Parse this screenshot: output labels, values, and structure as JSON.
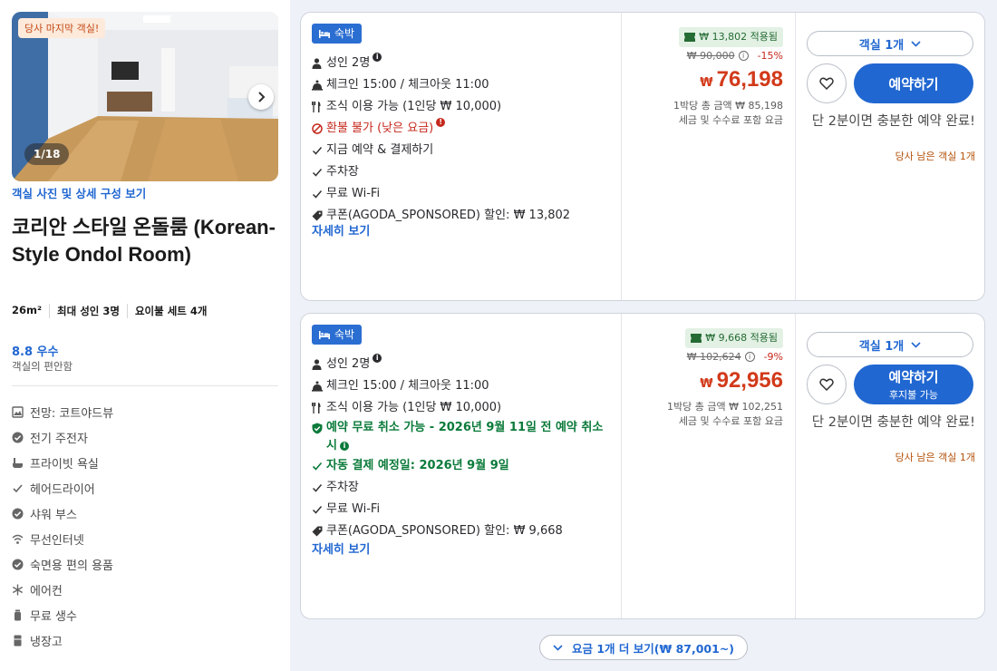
{
  "room": {
    "badge": "당사 마지막 객실!",
    "photo_counter": "1/18",
    "photo_link": "객실 사진 및 상세 구성 보기",
    "title": "코리안 스타일 온돌룸 (Korean-Style Ondol Room)",
    "specs": [
      "26m²",
      "최대 성인 3명",
      "요이불 세트 4개"
    ],
    "score": "8.8 우수",
    "score_sub": "객실의 편안함",
    "amenities": [
      {
        "icon": "view-icon",
        "label": "전망: 코트야드뷰"
      },
      {
        "icon": "check-circle-icon",
        "label": "전기 주전자"
      },
      {
        "icon": "bathtub-icon",
        "label": "프라이빗 욕실"
      },
      {
        "icon": "check-icon",
        "label": "헤어드라이어"
      },
      {
        "icon": "check-circle-icon",
        "label": "샤워 부스"
      },
      {
        "icon": "wifi-icon",
        "label": "무선인터넷"
      },
      {
        "icon": "check-circle-icon",
        "label": "숙면용 편의 용품"
      },
      {
        "icon": "snowflake-icon",
        "label": "에어컨"
      },
      {
        "icon": "water-drop-icon",
        "label": "무료 생수"
      },
      {
        "icon": "fridge-icon",
        "label": "냉장고"
      }
    ]
  },
  "offers": [
    {
      "stay_badge": "숙박",
      "features": {
        "adults": "성인 2명",
        "checkin": "체크인 15:00 / 체크아웃 11:00",
        "breakfast": "조식 이용 가능 (1인당 ₩ 10,000)",
        "refund": "환불 불가 (낮은 요금)",
        "pay_now": "지금 예약 & 결제하기",
        "parking": "주차장",
        "wifi": "무료 Wi-Fi",
        "coupon": "쿠폰(AGODA_SPONSORED) 할인: ₩ 13,802"
      },
      "detail_link": "자세히 보기",
      "coupon_chip": "₩ 13,802 적용됨",
      "original_price": "₩ 90,000",
      "discount": "-15%",
      "currency": "₩",
      "price": "76,198",
      "total": "1박당 총 금액 ₩ 85,198",
      "tax_note": "세금 및 수수료 포함 요금",
      "room_select": "객실 1개",
      "book_label": "예약하기",
      "hurry": "단 2분이면 충분한 예약 완료!",
      "rooms_left": "당사 남은 객실 1개"
    },
    {
      "stay_badge": "숙박",
      "features": {
        "adults": "성인 2명",
        "checkin": "체크인 15:00 / 체크아웃 11:00",
        "breakfast": "조식 이용 가능 (1인당 ₩ 10,000)",
        "free_cancel": "예약 무료 취소 가능 - 2026년 9월 11일 전 예약 취소 시",
        "auto_pay": "자동 결제 예정일: 2026년 9월 9일",
        "parking": "주차장",
        "wifi": "무료 Wi-Fi",
        "coupon": "쿠폰(AGODA_SPONSORED) 할인: ₩ 9,668"
      },
      "detail_link": "자세히 보기",
      "coupon_chip": "₩ 9,668 적용됨",
      "original_price": "₩ 102,624",
      "discount": "-9%",
      "currency": "₩",
      "price": "92,956",
      "total": "1박당 총 금액 ₩ 102,251",
      "tax_note": "세금 및 수수료 포함 요금",
      "room_select": "객실 1개",
      "book_label": "예약하기",
      "book_sub": "후지불 가능",
      "hurry": "단 2분이면 충분한 예약 완료!",
      "rooms_left": "당사 남은 객실 1개"
    }
  ],
  "more_rates": "요금 1개 더 보기(₩ 87,001~)",
  "colors": {
    "primary": "#2167d1",
    "price_red": "#d23a1a",
    "green": "#0b7a3a",
    "panel_bg": "#eef1f7"
  }
}
